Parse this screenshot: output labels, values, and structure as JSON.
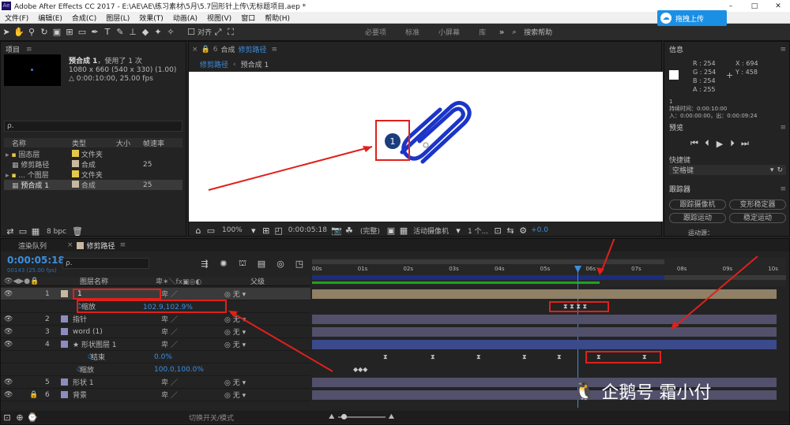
{
  "window": {
    "title": "Adobe After Effects CC 2017 - E:\\AE\\AE\\练习素材\\5月\\5.7回形针上传\\无标题项目.aep *",
    "cloud_button": "拖拽上传"
  },
  "menu": [
    "文件(F)",
    "编辑(E)",
    "合成(C)",
    "图层(L)",
    "效果(T)",
    "动画(A)",
    "视图(V)",
    "窗口",
    "帮助(H)"
  ],
  "toolbar": {
    "align_label": "对齐",
    "workspaces": [
      "必要项",
      "标准",
      "小屏幕",
      "库"
    ],
    "search_placeholder": "搜索帮助"
  },
  "project": {
    "title": "项目",
    "comp_name": "预合成 1",
    "used": "，使用了 1 次",
    "dims": "1080 x 660  (540 x 330) (1.00)",
    "duration": "△ 0:00:10:00, 25.00 fps",
    "search": "ρ.",
    "columns": [
      "名称",
      "类型",
      "大小",
      "帧速率"
    ],
    "items": [
      {
        "name": "固态层",
        "type": "文件夹",
        "fps": "",
        "color": "#e6c84a"
      },
      {
        "name": "修剪路径",
        "type": "合成",
        "fps": "25",
        "color": "#c8b8a0"
      },
      {
        "name": "... 个图层",
        "type": "文件夹",
        "fps": "",
        "color": "#e6c84a"
      },
      {
        "name": "预合成 1",
        "type": "合成",
        "fps": "25",
        "color": "#c8b8a0"
      }
    ],
    "bpc": "8 bpc"
  },
  "viewer": {
    "tab_prefix": "合成",
    "tab_name": "修剪路径",
    "crumbs": [
      "修剪路径",
      "预合成 1"
    ],
    "zoom": "100%",
    "timecode": "0:00:05:18",
    "quality": "(完整)",
    "camera": "活动摄像机",
    "views": "1 个...",
    "offset": "+0.0",
    "badge_number": "1"
  },
  "info": {
    "title": "信息",
    "r": "R : 254",
    "g": "G : 254",
    "b": "B : 254",
    "a": "A : 255",
    "x": "X : 694",
    "y": "Y : 458",
    "line1": "1",
    "line2": "持续时间：0:00:10:00",
    "line3": "入：0:00:00:00，出：0:00:09:24"
  },
  "preview": {
    "title": "预览"
  },
  "shortcut": {
    "title": "快捷键",
    "value": "空格键"
  },
  "tracker": {
    "title": "跟踪器",
    "buttons": [
      "跟踪摄像机",
      "变形稳定器",
      "跟踪运动",
      "稳定运动"
    ],
    "more": "运动源："
  },
  "timeline": {
    "tabs": [
      "渲染队列",
      "修剪路径"
    ],
    "timecode": "0:00:05:18",
    "frames": "00143 (25.00 fps)",
    "search": "ρ.",
    "header_name": "图层名称",
    "header_parent": "父级",
    "ruler": [
      "00s",
      "01s",
      "02s",
      "03s",
      "04s",
      "05s",
      "06s",
      "07s",
      "08s",
      "09s",
      "10s"
    ],
    "switch_label": "切换开关/模式",
    "layers": [
      {
        "num": "1",
        "name": "1",
        "parent": "无",
        "color": "#c8b8a0",
        "kind": "comp"
      },
      {
        "num": "",
        "name": "缩放",
        "value": "102.9,102.9%",
        "parent": "",
        "kind": "prop"
      },
      {
        "num": "2",
        "name": "指针",
        "parent": "无",
        "color": "#8c8cc0",
        "kind": "layer"
      },
      {
        "num": "3",
        "name": "word (1)",
        "parent": "无",
        "color": "#8c8cc0",
        "kind": "layer"
      },
      {
        "num": "4",
        "name": "形状图层 1",
        "parent": "无",
        "color": "#8c8cc0",
        "kind": "shape"
      },
      {
        "num": "",
        "name": "结束",
        "value": "0.0%",
        "parent": "",
        "kind": "prop"
      },
      {
        "num": "",
        "name": "缩放",
        "value": "100.0,100.0%",
        "parent": "",
        "kind": "prop"
      },
      {
        "num": "5",
        "name": "形状 1",
        "parent": "无",
        "color": "#8c8cc0",
        "kind": "layer"
      },
      {
        "num": "6",
        "name": "背景",
        "parent": "无",
        "color": "#8c8cc0",
        "kind": "layer"
      }
    ]
  },
  "watermark": "企鹅号 霜小付",
  "colors": {
    "accent": "#3b8fe0",
    "red": "#e0201b",
    "paperclip": "#1b35c8"
  }
}
